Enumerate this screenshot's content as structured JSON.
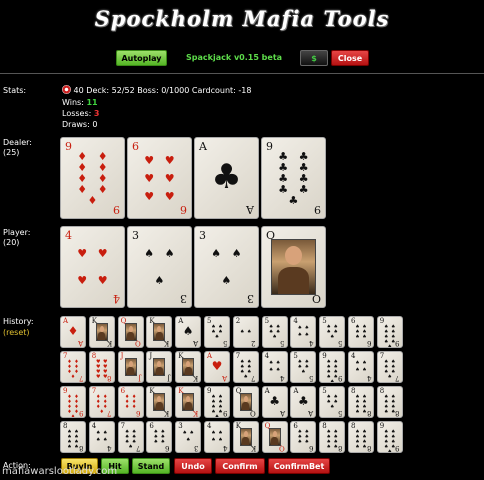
{
  "header": {
    "title": "Spockholm Mafia Tools",
    "version": "Spackjack v0.15 beta"
  },
  "toolbar": {
    "autoplay_label": "Autoplay",
    "dollar_label": "$",
    "close_label": "Close"
  },
  "stats": {
    "label": "Stats:",
    "count": "40",
    "line1": "Deck: 52/52 Boss: 0/1000 Cardcount: -18",
    "wins_label": "Wins:",
    "wins": "11",
    "losses_label": "Losses:",
    "losses": "3",
    "draws_label": "Draws:",
    "draws": "0"
  },
  "dealer": {
    "label": "Dealer:",
    "score": "(25)",
    "cards": [
      {
        "rank": "9",
        "suit": "♦",
        "color": "red"
      },
      {
        "rank": "6",
        "suit": "♥",
        "color": "red"
      },
      {
        "rank": "A",
        "suit": "♣",
        "color": "black"
      },
      {
        "rank": "9",
        "suit": "♣",
        "color": "black"
      }
    ]
  },
  "player": {
    "label": "Player:",
    "score": "(20)",
    "cards": [
      {
        "rank": "4",
        "suit": "♥",
        "color": "red"
      },
      {
        "rank": "3",
        "suit": "♠",
        "color": "black"
      },
      {
        "rank": "3",
        "suit": "♠",
        "color": "black"
      },
      {
        "rank": "Q",
        "suit": "♠",
        "color": "black",
        "face": true
      }
    ]
  },
  "history": {
    "label": "History:",
    "reset_label": "(reset)",
    "rows": [
      [
        {
          "r": "A",
          "s": "♦",
          "c": "red"
        },
        {
          "r": "K",
          "s": "♠",
          "c": "black",
          "f": true
        },
        {
          "r": "Q",
          "s": "♥",
          "c": "red",
          "f": true
        },
        {
          "r": "K",
          "s": "♠",
          "c": "black",
          "f": true
        },
        {
          "r": "A",
          "s": "♠",
          "c": "black"
        },
        {
          "r": "5",
          "s": "♠",
          "c": "black"
        },
        {
          "r": "2",
          "s": "♠",
          "c": "black"
        },
        {
          "r": "5",
          "s": "♠",
          "c": "black"
        },
        {
          "r": "4",
          "s": "♠",
          "c": "black"
        },
        {
          "r": "5",
          "s": "♠",
          "c": "black"
        },
        {
          "r": "6",
          "s": "♠",
          "c": "black"
        },
        {
          "r": "9",
          "s": "♠",
          "c": "black"
        }
      ],
      [
        {
          "r": "7",
          "s": "♦",
          "c": "red"
        },
        {
          "r": "8",
          "s": "♥",
          "c": "red"
        },
        {
          "r": "J",
          "s": "♦",
          "c": "red",
          "f": true
        },
        {
          "r": "J",
          "s": "♠",
          "c": "black",
          "f": true
        },
        {
          "r": "K",
          "s": "♠",
          "c": "black",
          "f": true
        },
        {
          "r": "A",
          "s": "♥",
          "c": "red"
        },
        {
          "r": "7",
          "s": "♠",
          "c": "black"
        },
        {
          "r": "4",
          "s": "♠",
          "c": "black"
        },
        {
          "r": "5",
          "s": "♠",
          "c": "black"
        },
        {
          "r": "9",
          "s": "♠",
          "c": "black"
        },
        {
          "r": "4",
          "s": "♠",
          "c": "black"
        },
        {
          "r": "7",
          "s": "♠",
          "c": "black"
        }
      ],
      [
        {
          "r": "9",
          "s": "♦",
          "c": "red"
        },
        {
          "r": "7",
          "s": "♦",
          "c": "red"
        },
        {
          "r": "6",
          "s": "♦",
          "c": "red"
        },
        {
          "r": "K",
          "s": "♠",
          "c": "black",
          "f": true
        },
        {
          "r": "K",
          "s": "♦",
          "c": "red",
          "f": true
        },
        {
          "r": "9",
          "s": "♠",
          "c": "black"
        },
        {
          "r": "Q",
          "s": "♠",
          "c": "black",
          "f": true
        },
        {
          "r": "A",
          "s": "♣",
          "c": "black"
        },
        {
          "r": "A",
          "s": "♣",
          "c": "black"
        },
        {
          "r": "5",
          "s": "♠",
          "c": "black"
        },
        {
          "r": "8",
          "s": "♠",
          "c": "black"
        },
        {
          "r": "8",
          "s": "♠",
          "c": "black"
        }
      ],
      [
        {
          "r": "8",
          "s": "♠",
          "c": "black"
        },
        {
          "r": "4",
          "s": "♠",
          "c": "black"
        },
        {
          "r": "7",
          "s": "♠",
          "c": "black"
        },
        {
          "r": "6",
          "s": "♠",
          "c": "black"
        },
        {
          "r": "3",
          "s": "♠",
          "c": "black"
        },
        {
          "r": "4",
          "s": "♠",
          "c": "black"
        },
        {
          "r": "K",
          "s": "♠",
          "c": "black",
          "f": true
        },
        {
          "r": "Q",
          "s": "♥",
          "c": "red",
          "f": true
        },
        {
          "r": "6",
          "s": "♠",
          "c": "black"
        },
        {
          "r": "8",
          "s": "♠",
          "c": "black"
        },
        {
          "r": "8",
          "s": "♠",
          "c": "black"
        },
        {
          "r": "9",
          "s": "♠",
          "c": "black"
        }
      ]
    ]
  },
  "actions": {
    "label": "Action:",
    "buyin": "BuyIn",
    "hit": "Hit",
    "stand": "Stand",
    "undo": "Undo",
    "confirm": "Confirm",
    "confirmbet": "ConfirmBet"
  },
  "watermark": "mafiawarslootlady.com"
}
